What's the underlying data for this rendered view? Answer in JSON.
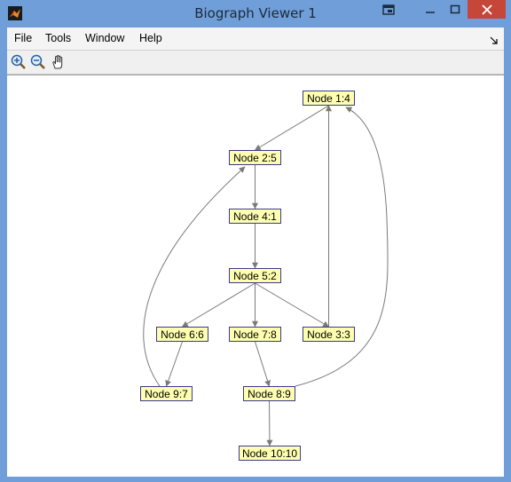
{
  "window": {
    "title": "Biograph Viewer 1"
  },
  "menu": {
    "items": [
      {
        "label": "File"
      },
      {
        "label": "Tools"
      },
      {
        "label": "Window"
      },
      {
        "label": "Help"
      }
    ]
  },
  "graph": {
    "nodes": [
      {
        "id": "n1",
        "label": "Node 1:4"
      },
      {
        "id": "n2",
        "label": "Node 2:5"
      },
      {
        "id": "n4",
        "label": "Node 4:1"
      },
      {
        "id": "n5",
        "label": "Node 5:2"
      },
      {
        "id": "n6",
        "label": "Node 6:6"
      },
      {
        "id": "n7",
        "label": "Node 7:8"
      },
      {
        "id": "n3",
        "label": "Node 3:3"
      },
      {
        "id": "n9",
        "label": "Node 9:7"
      },
      {
        "id": "n8",
        "label": "Node 8:9"
      },
      {
        "id": "n10",
        "label": "Node 10:10"
      }
    ],
    "edges": [
      {
        "from": "n1",
        "to": "n2"
      },
      {
        "from": "n2",
        "to": "n4"
      },
      {
        "from": "n4",
        "to": "n5"
      },
      {
        "from": "n5",
        "to": "n6"
      },
      {
        "from": "n5",
        "to": "n7"
      },
      {
        "from": "n5",
        "to": "n3"
      },
      {
        "from": "n3",
        "to": "n1"
      },
      {
        "from": "n6",
        "to": "n9"
      },
      {
        "from": "n9",
        "to": "n2"
      },
      {
        "from": "n7",
        "to": "n8"
      },
      {
        "from": "n8",
        "to": "n1"
      },
      {
        "from": "n8",
        "to": "n10"
      }
    ]
  },
  "colors": {
    "node_fill": "#ffffb0",
    "node_border": "#3a3a8a",
    "edge": "#7a7a7a",
    "title_bar": "#6f9ed8",
    "close_button": "#c7463a"
  }
}
